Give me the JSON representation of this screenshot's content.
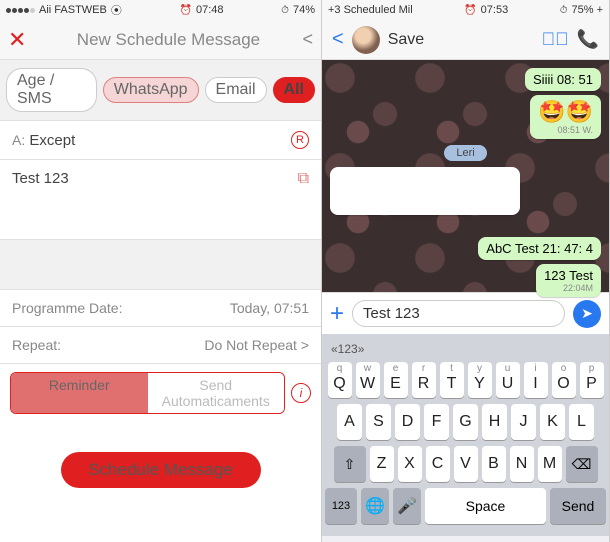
{
  "left": {
    "status": {
      "carrier": "Aii FASTWEB",
      "time": "07:48",
      "battery": "74%"
    },
    "nav": {
      "title": "New Schedule Message"
    },
    "filters": {
      "sms": "Age / SMS",
      "whatsapp": "WhatsApp",
      "email": "Email",
      "all": "All"
    },
    "recipient": {
      "label": "A:",
      "value": "Except"
    },
    "message": "Test 123",
    "prog_date": {
      "label": "Programme Date:",
      "value": "Today, 07:51"
    },
    "repeat": {
      "label": "Repeat:",
      "value": "Do Not Repeat >"
    },
    "segment": {
      "reminder": "Reminder",
      "auto": "Send Automaticaments"
    },
    "schedule_btn": "Schedule Message"
  },
  "right": {
    "status": {
      "title": "+3 Scheduled Mil",
      "time": "07:53",
      "battery": "75% +"
    },
    "nav": {
      "save": "Save"
    },
    "chat": {
      "msg1": {
        "text": "Siiii 08: 51",
        "time": "08:51 W."
      },
      "msg2_emoji": "🤩🤩",
      "date_chip": "Leri",
      "msg3": "",
      "msg4": "AbC Test 21: 47: 4",
      "msg5": {
        "text": "123 Test",
        "time": "22:04M"
      }
    },
    "input": {
      "text": "Test 123"
    },
    "keyboard": {
      "hint": "«123»",
      "row1": [
        {
          "s": "q",
          "l": "Q"
        },
        {
          "s": "w",
          "l": "W"
        },
        {
          "s": "e",
          "l": "E"
        },
        {
          "s": "r",
          "l": "R"
        },
        {
          "s": "t",
          "l": "T"
        },
        {
          "s": "y",
          "l": "Y"
        },
        {
          "s": "u",
          "l": "U"
        },
        {
          "s": "i",
          "l": "I"
        },
        {
          "s": "o",
          "l": "O"
        },
        {
          "s": "p",
          "l": "P"
        }
      ],
      "row2": [
        {
          "l": "A"
        },
        {
          "l": "S"
        },
        {
          "l": "D"
        },
        {
          "l": "F"
        },
        {
          "l": "G"
        },
        {
          "l": "H"
        },
        {
          "l": "J"
        },
        {
          "l": "K"
        },
        {
          "l": "L"
        }
      ],
      "row3": [
        {
          "l": "Z"
        },
        {
          "l": "X"
        },
        {
          "l": "C"
        },
        {
          "l": "V"
        },
        {
          "l": "B"
        },
        {
          "l": "N"
        },
        {
          "l": "M"
        }
      ],
      "num": "123",
      "space": "Space",
      "send": "Send"
    }
  }
}
